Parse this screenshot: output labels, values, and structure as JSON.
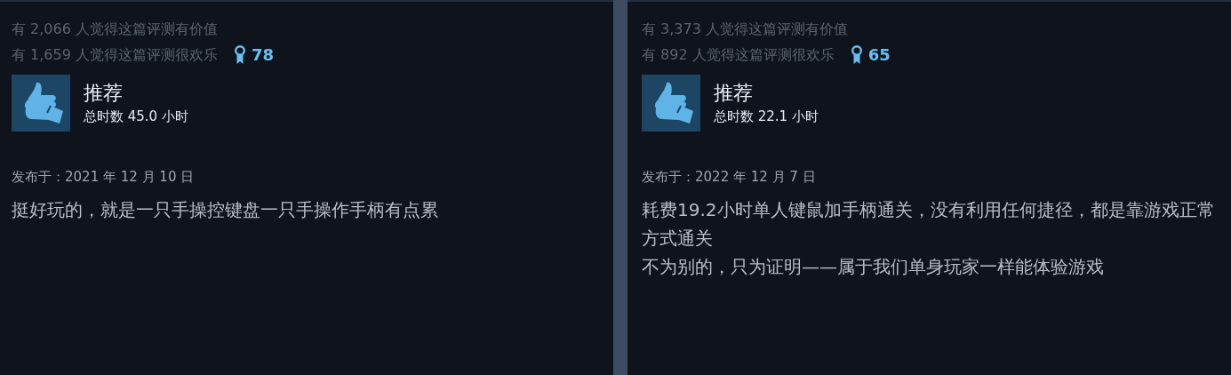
{
  "reviews": [
    {
      "helpful": "有 2,066 人觉得这篇评测有价值",
      "funny": "有 1,659 人觉得这篇评测很欢乐",
      "awards": "78",
      "verdict": "推荐",
      "recommended": true,
      "hours": "总时数 45.0 小时",
      "posted": "发布于：2021 年 12 月 10 日",
      "body": [
        "挺好玩的，就是一只手操控键盘一只手操作手柄有点累"
      ]
    },
    {
      "helpful": "有 3,373 人觉得这篇评测有价值",
      "funny": "有 892 人觉得这篇评测很欢乐",
      "awards": "65",
      "verdict": "推荐",
      "recommended": true,
      "hours": "总时数 22.1 小时",
      "posted": "发布于：2022 年 12 月 7 日",
      "body": [
        "耗费19.2小时单人键鼠加手柄通关，没有利用任何捷径，都是靠游戏正常方式通关",
        "不为别的，只为证明——属于我们单身玩家一样能体验游戏"
      ]
    }
  ]
}
